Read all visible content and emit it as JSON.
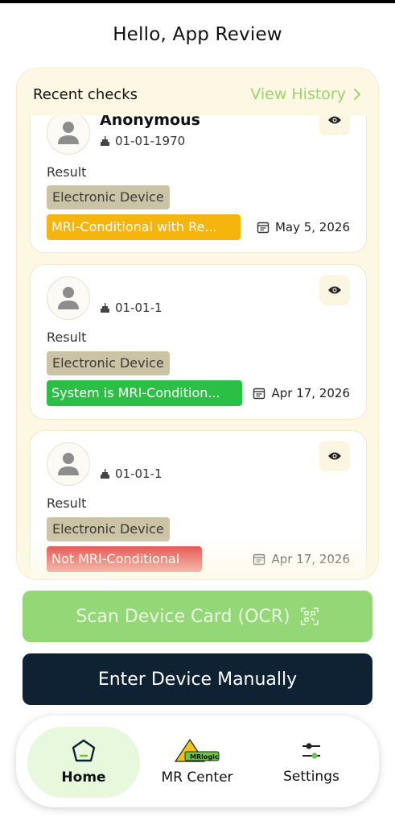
{
  "greeting": "Hello, App Review",
  "recent": {
    "title": "Recent checks",
    "view_history": "View History",
    "cards": [
      {
        "name": "Anonymous",
        "dob": "01-01-1970",
        "result_label": "Result",
        "device_type": "Electronic Device",
        "status": "MRI-Conditional with Re...",
        "status_color": "#f5b50c",
        "date": "May 5, 2026"
      },
      {
        "name": "",
        "dob": "01-01-1",
        "result_label": "Result",
        "device_type": "Electronic Device",
        "status": "System is MRI-Condition...",
        "status_color": "#2cbf45",
        "date": "Apr 17, 2026"
      },
      {
        "name": "",
        "dob": "01-01-1",
        "result_label": "Result",
        "device_type": "Electronic Device",
        "status": "Not MRI-Conditional",
        "status_color": "#e03434",
        "date": "Apr 17, 2026"
      }
    ]
  },
  "actions": {
    "scan_label": "Scan Device Card (OCR)",
    "manual_label": "Enter Device Manually"
  },
  "nav": {
    "items": [
      {
        "label": "Home",
        "icon": "home-icon",
        "active": true
      },
      {
        "label": "MR Center",
        "icon": "mrlogic-logo-icon",
        "active": false
      },
      {
        "label": "Settings",
        "icon": "sliders-icon",
        "active": false
      }
    ],
    "logo_text": "MRlogic"
  },
  "colors": {
    "accent_green": "#9dd26b",
    "scan_button": "#93d777",
    "manual_button": "#0f2233",
    "panel_bg": "#fdf8e4"
  }
}
